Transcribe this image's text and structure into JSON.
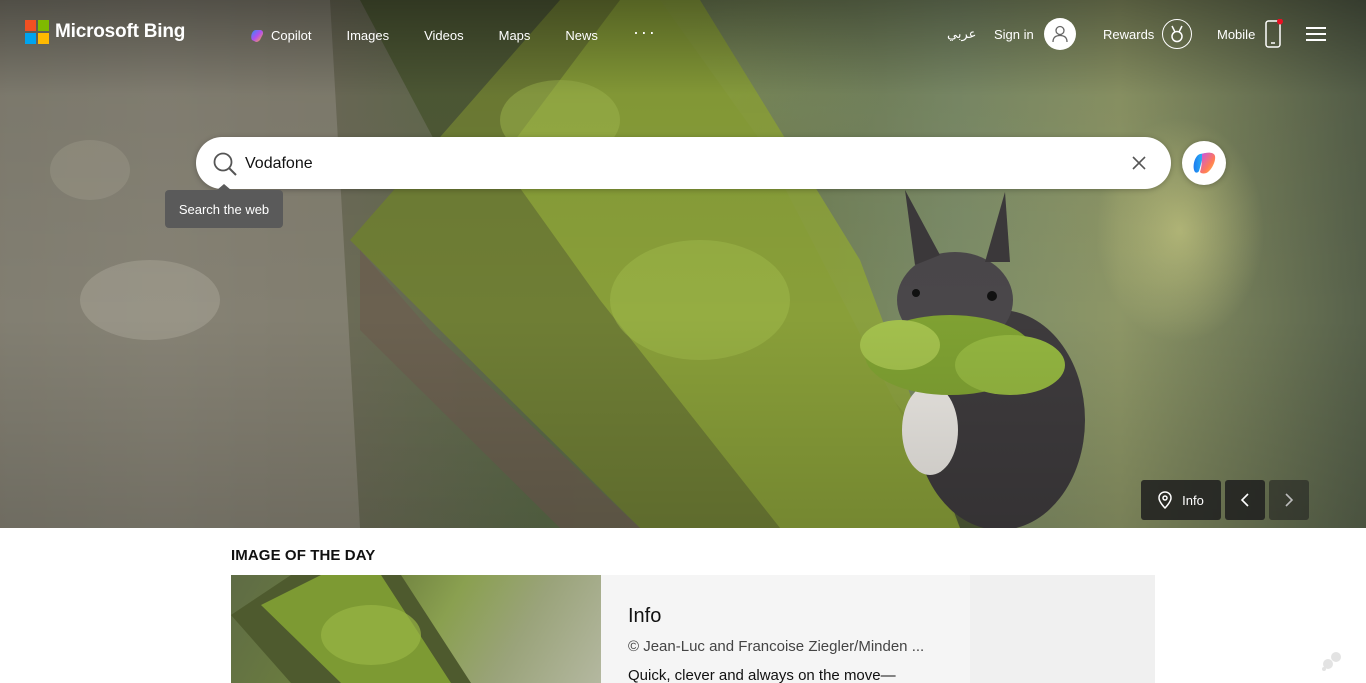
{
  "brand": {
    "name": "Microsoft Bing",
    "logo_colors": [
      "#f25022",
      "#7fba00",
      "#00a4ef",
      "#ffb900"
    ]
  },
  "nav": {
    "items": [
      {
        "label": "Copilot",
        "icon": "copilot-icon"
      },
      {
        "label": "Images"
      },
      {
        "label": "Videos"
      },
      {
        "label": "Maps"
      },
      {
        "label": "News"
      }
    ],
    "more": "···"
  },
  "header_right": {
    "language": "عربي",
    "sign_in": "Sign in",
    "rewards": "Rewards",
    "mobile": "Mobile",
    "notification_color": "#e81123"
  },
  "search": {
    "value": "Vodafone",
    "tooltip": "Search the web"
  },
  "hero": {
    "info_label": "Info"
  },
  "image_of_the_day": {
    "heading": "IMAGE OF THE DAY",
    "title": "Info",
    "credit": "© Jean-Luc and Francoise Ziegler/Minden ...",
    "description": "Quick, clever and always on the move—"
  }
}
